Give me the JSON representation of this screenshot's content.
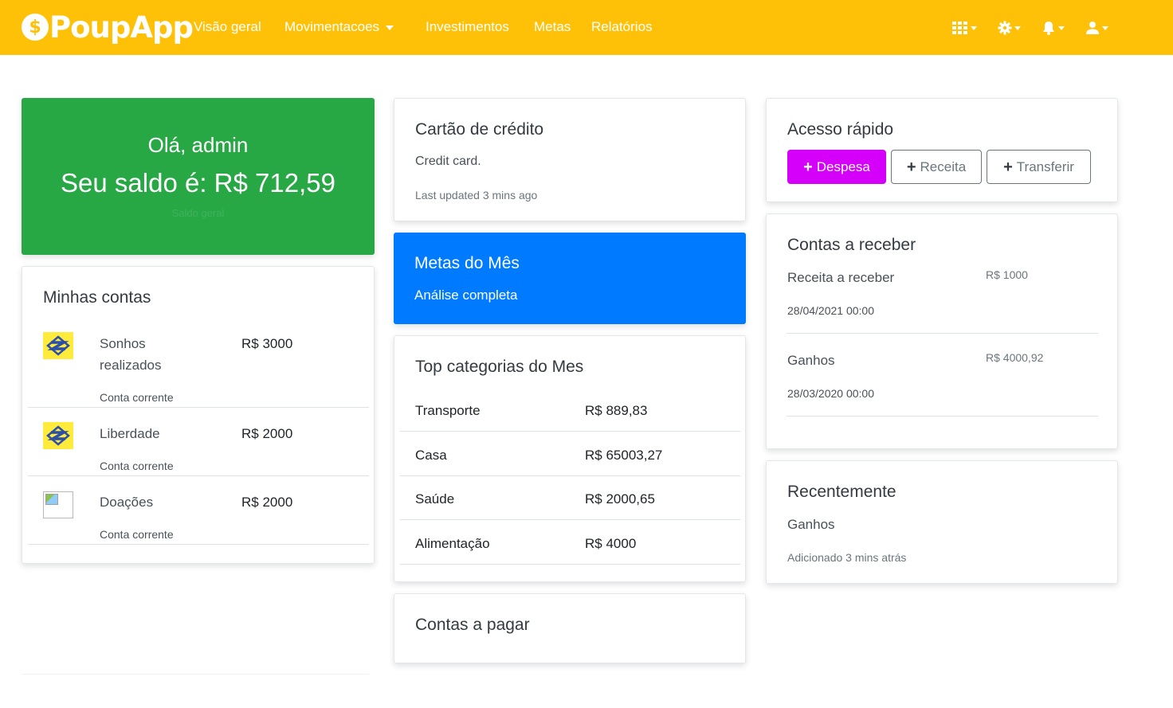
{
  "navbar": {
    "brand_symbol": "$",
    "brand": "PoupApp",
    "links": [
      {
        "label": "Visão geral"
      },
      {
        "label": "Movimentacoes"
      },
      {
        "label": "Investimentos"
      },
      {
        "label": "Metas"
      },
      {
        "label": "Relatórios"
      }
    ],
    "icons": [
      "apps-grid-icon",
      "gear-icon",
      "bell-icon",
      "user-icon"
    ],
    "color": "#ffc107"
  },
  "welcome": {
    "greeting": "Olá, admin",
    "balance_text": "Seu saldo é: R$ 712,59",
    "subtitle": "Saldo geral",
    "color": "#28a745"
  },
  "accounts": {
    "title": "Minhas contas",
    "items": [
      {
        "name": "Sonhos realizados",
        "value": "R$ 3000",
        "type": "Conta corrente",
        "logo": "banco-do-brasil-logo"
      },
      {
        "name": "Liberdade",
        "value": "R$ 2000",
        "type": "Conta corrente",
        "logo": "banco-do-brasil-logo"
      },
      {
        "name": "Doações",
        "value": "R$ 2000",
        "type": "Conta corrente",
        "logo": "broken-image"
      }
    ]
  },
  "credit_card": {
    "title": "Cartão de crédito",
    "text": "Credit card.",
    "updated": "Last updated 3 mins ago"
  },
  "goals": {
    "title": "Metas do Mês",
    "subtitle": "Análise completa",
    "color": "#007bff"
  },
  "top_categories": {
    "title": "Top categorias do Mes",
    "rows": [
      {
        "name": "Transporte",
        "value": "R$ 889,83"
      },
      {
        "name": "Casa",
        "value": "R$ 65003,27"
      },
      {
        "name": "Saúde",
        "value": "R$ 2000,65"
      },
      {
        "name": "Alimentação",
        "value": "R$ 4000"
      }
    ]
  },
  "bills_to_pay": {
    "title": "Contas a pagar"
  },
  "quick_access": {
    "title": "Acesso rápido",
    "buttons": [
      {
        "label": "Despesa",
        "style": "primary",
        "color": "#d500f9"
      },
      {
        "label": "Receita",
        "style": "outline"
      },
      {
        "label": "Transferir",
        "style": "outline"
      }
    ]
  },
  "receivables": {
    "title": "Contas a receber",
    "items": [
      {
        "name": "Receita a receber",
        "value": "R$ 1000",
        "date": "28/04/2021 00:00"
      },
      {
        "name": "Ganhos",
        "value": "R$ 4000,92",
        "date": "28/03/2020 00:00"
      }
    ]
  },
  "recent": {
    "title": "Recentemente",
    "item": "Ganhos",
    "added": "Adicionado 3 mins atrás"
  }
}
